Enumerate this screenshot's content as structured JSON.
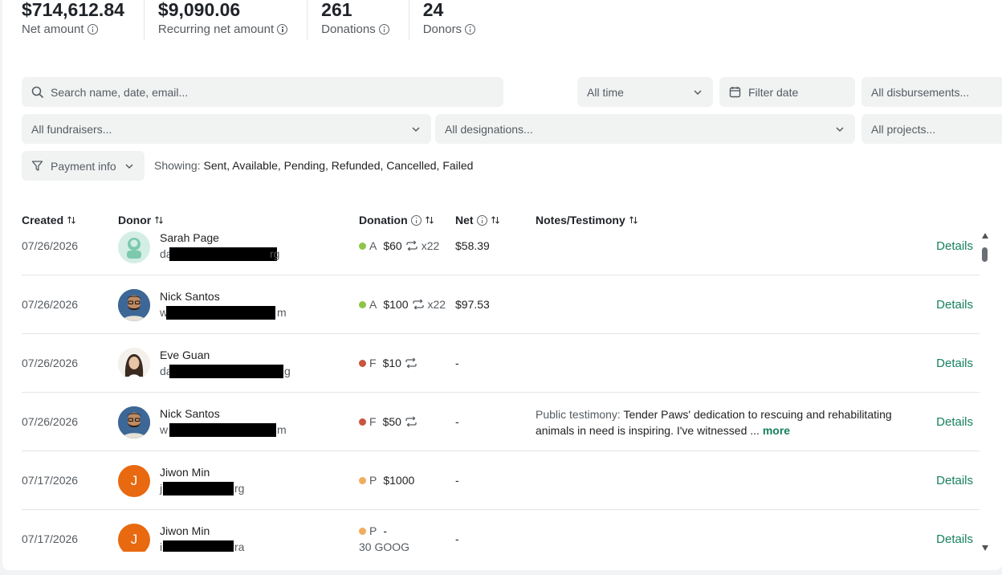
{
  "stats": [
    {
      "value": "$714,612.84",
      "label": "Net amount"
    },
    {
      "value": "$9,090.06",
      "label": "Recurring net amount"
    },
    {
      "value": "261",
      "label": "Donations"
    },
    {
      "value": "24",
      "label": "Donors"
    }
  ],
  "filters": {
    "search_placeholder": "Search name, date, email...",
    "time": "All time",
    "date_placeholder": "Filter date",
    "disbursements": "All disbursements...",
    "fundraisers": "All fundraisers...",
    "designations": "All designations...",
    "projects": "All projects...",
    "payment_info": "Payment info",
    "showing_label": "Showing:",
    "showing_value": "Sent, Available, Pending, Refunded, Cancelled, Failed"
  },
  "columns": {
    "created": "Created",
    "donor": "Donor",
    "donation": "Donation",
    "net": "Net",
    "notes": "Notes/Testimony"
  },
  "rows": [
    {
      "date": "07/26/2026",
      "name": "Sarah Page",
      "email_start": "da",
      "email_end": "rg",
      "status_color": "#8fc44a",
      "status": "A",
      "amount": "$60",
      "recurring": "x22",
      "net": "$58.39",
      "details": "Details"
    },
    {
      "date": "07/26/2026",
      "name": "Nick Santos",
      "email_start": "w",
      "email_end": "m",
      "status_color": "#8fc44a",
      "status": "A",
      "amount": "$100",
      "recurring": "x22",
      "net": "$97.53",
      "details": "Details"
    },
    {
      "date": "07/26/2026",
      "name": "Eve Guan",
      "email_start": "da",
      "email_end": "g",
      "status_color": "#c8553d",
      "status": "F",
      "amount": "$10",
      "recurring": "",
      "net": "-",
      "details": "Details"
    },
    {
      "date": "07/26/2026",
      "name": "Nick Santos",
      "email_start": "w",
      "email_end": "m",
      "status_color": "#c8553d",
      "status": "F",
      "amount": "$50",
      "recurring": "",
      "net": "-",
      "notes_label": "Public testimony:",
      "notes_text": "Tender Paws' dedication to rescuing and rehabilitating animals in need is inspiring. I've witnessed ...",
      "notes_more": "more",
      "details": "Details"
    },
    {
      "date": "07/17/2026",
      "name": "Jiwon Min",
      "email_start": "j",
      "email_end": "rg",
      "status_color": "#f0ad5e",
      "status": "P",
      "amount": "$1000",
      "recurring": "",
      "net": "-",
      "details": "Details",
      "initial": "J"
    },
    {
      "date": "07/17/2026",
      "name": "Jiwon Min",
      "email_start": "i",
      "email_end": "ra",
      "status_color": "#f0ad5e",
      "status": "P",
      "amount": "-",
      "amount_line2": "30 GOOG",
      "recurring": "",
      "net": "-",
      "details": "Details",
      "initial": "J"
    }
  ],
  "colors": {
    "accent": "#16805f",
    "avatar_orange": "#e8690f"
  }
}
